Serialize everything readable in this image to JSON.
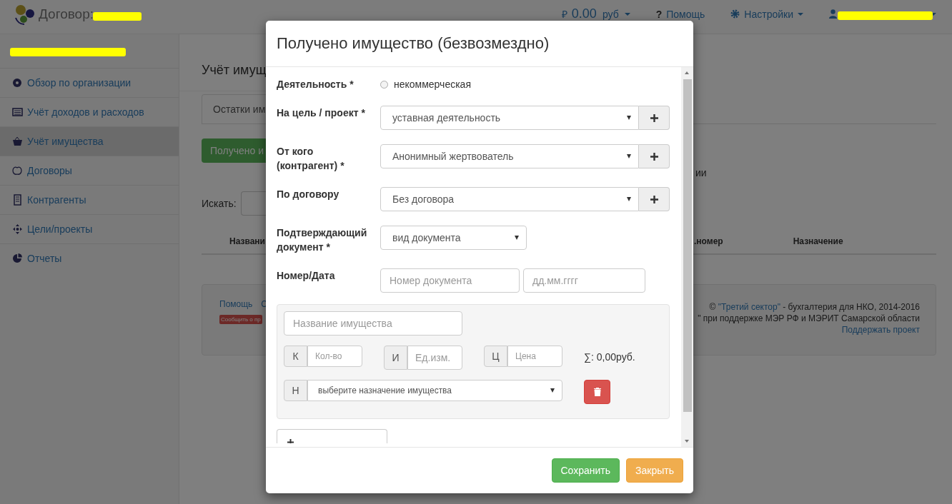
{
  "navbar": {
    "title": "Договор:",
    "balance": {
      "currency": "₽",
      "amount": "0.00",
      "unit": "руб"
    },
    "help": {
      "icon": "?",
      "label": "Помощь"
    },
    "settings": {
      "label": "Настройки"
    }
  },
  "sidebar": {
    "items": [
      {
        "label": "Обзор по организации",
        "selected": false
      },
      {
        "label": "Учёт доходов и расходов",
        "selected": false
      },
      {
        "label": "Учёт имущества",
        "selected": true
      },
      {
        "label": "Договоры",
        "selected": false
      },
      {
        "label": "Контрагенты",
        "selected": false
      },
      {
        "label": "Цели/проекты",
        "selected": false
      },
      {
        "label": "Отчеты",
        "selected": false
      }
    ]
  },
  "page": {
    "title": "Учёт имущ",
    "tab": "Остатки им",
    "action_button": "Получено и",
    "fragment": "ии",
    "search_label": "Искать:",
    "columns": [
      "Названи",
      ".номер",
      "Назначение"
    ],
    "footer": {
      "links": [
        "Помощь",
        "С"
      ],
      "report_badge": "Сообщить о пр",
      "copyright_prefix": "©",
      "copyright_link": "\"Третий сектор\"",
      "copyright_suffix": "- бухгалтерия для НКО, 2014-2016",
      "support_line": "\" при поддержке МЭР РФ и МЭРИТ Самарской области",
      "support_link": "Поддержать проект"
    }
  },
  "modal": {
    "title": "Получено имущество (безвозмездно)",
    "fields": [
      {
        "kind": "radio",
        "label": "Деятельность *",
        "option": "некоммерческая",
        "checked": false
      },
      {
        "kind": "select",
        "label": "На цель / проект *",
        "value": "уставная деятельность",
        "add": true
      },
      {
        "kind": "select",
        "label": "От кого (контрагент) *",
        "value": "Анонимный жертвователь",
        "add": true
      },
      {
        "kind": "select",
        "label": "По договору",
        "value": "Без договора",
        "add": true
      },
      {
        "kind": "select",
        "label": "Подтверждающий документ *",
        "value": "вид документа",
        "add": false
      },
      {
        "kind": "pair",
        "label": "Номер/Дата",
        "inputs": [
          {
            "placeholder": "Номер документа"
          },
          {
            "placeholder": "дд.мм.гггг"
          }
        ]
      }
    ],
    "item": {
      "name_placeholder": "Название имущества",
      "addons": [
        {
          "prefix": "К",
          "placeholder": "Кол-во"
        },
        {
          "prefix": "И",
          "placeholder": "Ед.изм."
        },
        {
          "prefix": "Ц",
          "placeholder": "Цена"
        }
      ],
      "total": "∑: 0,00руб.",
      "purpose": {
        "prefix": "Н",
        "value": "выберите назначение имущества"
      }
    },
    "buttons": [
      {
        "label": "Сохранить",
        "kind": "primary"
      },
      {
        "label": "Закрыть",
        "kind": "warning"
      }
    ]
  }
}
